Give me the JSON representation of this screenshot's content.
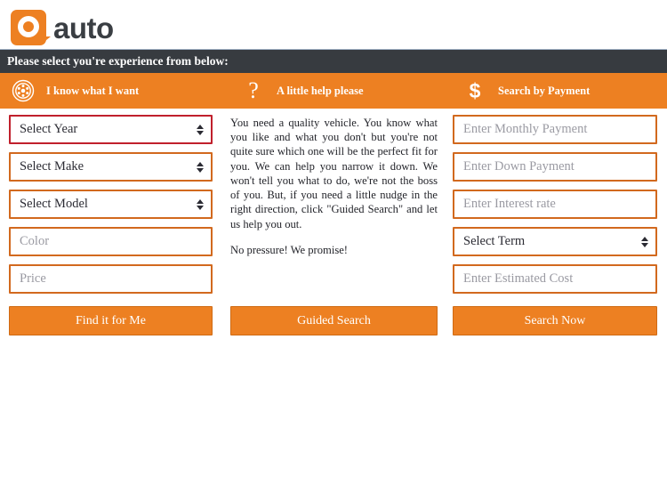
{
  "brand": {
    "logo_mark": "Q",
    "logo_word": "auto",
    "logo_color": "#ED8022",
    "word_color": "#3A3E43"
  },
  "instruction_bar": {
    "text": "Please select you're experience from below:",
    "background": "#373B40",
    "text_color": "#FFFFFF"
  },
  "nav": {
    "background": "#ED8022",
    "items": [
      {
        "icon": "wheel-icon",
        "label": "I know what I want"
      },
      {
        "icon": "question-mark-icon",
        "label": "A little help please"
      },
      {
        "icon": "dollar-sign-icon",
        "label": "Search by Payment"
      }
    ]
  },
  "left_column": {
    "fields": [
      {
        "type": "select",
        "value": "Select Year",
        "state": "error",
        "border": "#C0202C"
      },
      {
        "type": "select",
        "value": "Select Make",
        "state": "normal",
        "border": "#D2691E"
      },
      {
        "type": "select",
        "value": "Select Model",
        "state": "normal",
        "border": "#D2691E"
      },
      {
        "type": "text",
        "value": "",
        "placeholder": "Color",
        "state": "normal",
        "border": "#D2691E"
      },
      {
        "type": "text",
        "value": "",
        "placeholder": "Price",
        "state": "normal",
        "border": "#D2691E"
      }
    ],
    "button_label": "Find it for Me"
  },
  "middle_column": {
    "paragraphs": [
      "You need a quality vehicle. You know what you like and what you don't but you're not quite sure which one will be the perfect fit for you. We can help you narrow it down. We won't tell you what to do, we're not the boss of you. But, if you need a little nudge in the right direction, click \"Guided Search\" and let us help you out.",
      "No pressure! We promise!"
    ],
    "button_label": "Guided Search"
  },
  "right_column": {
    "fields": [
      {
        "type": "text",
        "value": "",
        "placeholder": "Enter Monthly Payment",
        "state": "normal",
        "border": "#D2691E"
      },
      {
        "type": "text",
        "value": "",
        "placeholder": "Enter Down Payment",
        "state": "normal",
        "border": "#D2691E"
      },
      {
        "type": "text",
        "value": "",
        "placeholder": "Enter Interest rate",
        "state": "normal",
        "border": "#D2691E"
      },
      {
        "type": "select",
        "value": "Select Term",
        "state": "normal",
        "border": "#D2691E"
      },
      {
        "type": "text",
        "value": "",
        "placeholder": "Enter Estimated Cost",
        "state": "normal",
        "border": "#D2691E"
      }
    ],
    "button_label": "Search Now"
  }
}
